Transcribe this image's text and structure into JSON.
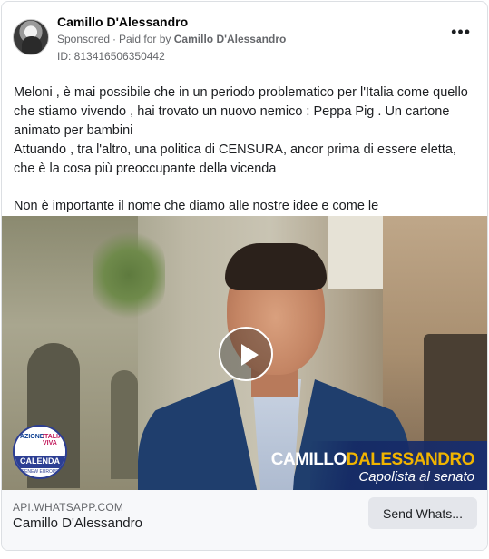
{
  "advertiser": {
    "name": "Camillo D'Alessandro",
    "sponsored_label": "Sponsored",
    "paid_for_prefix": "Paid for by",
    "paid_for_name": "Camillo D'Alessandro",
    "ad_id": "ID: 813416506350442",
    "more_icon": "more-horizontal-icon"
  },
  "post": {
    "paragraph1": "Meloni , è mai possibile che in un periodo problematico per l'Italia come quello che stiamo vivendo , hai trovato un nuovo nemico : Peppa Pig . Un cartone animato per bambini",
    "paragraph2": "Attuando , tra l'altro, una politica di CENSURA, ancor prima di essere eletta, che è la cosa più preoccupante della vicenda",
    "paragraph3": "Non è importante il nome che diamo alle nostre idee e come le rappresentiamo..."
  },
  "video": {
    "play_icon": "play-icon",
    "caption_name_part1": "CAMILLO",
    "caption_name_part2": "DALESSANDRO",
    "caption_subtitle": "Capolista al senato",
    "logo_top_left": "AZIONE",
    "logo_top_right": "ITALIA VIVA",
    "logo_main": "CALENDA",
    "logo_sub": "RENEW EUROPE",
    "accent_color": "#f0b400"
  },
  "footer": {
    "domain": "API.WHATSAPP.COM",
    "title": "Camillo D'Alessandro",
    "cta_label": "Send Whats..."
  }
}
